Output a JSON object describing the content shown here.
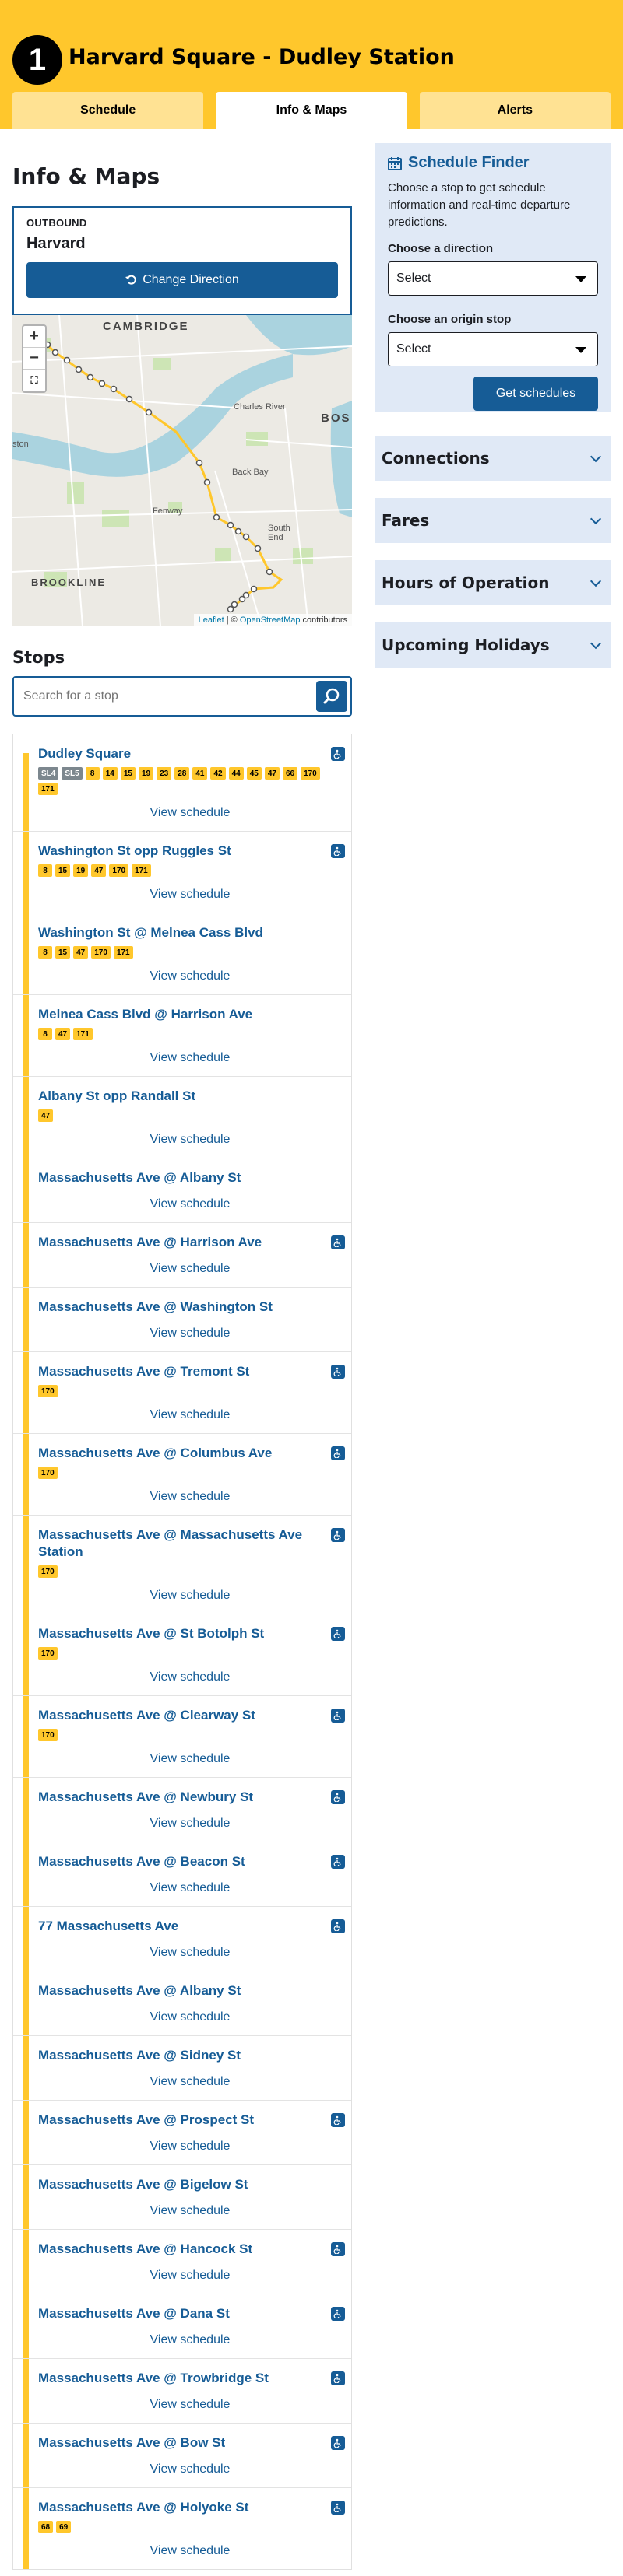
{
  "header": {
    "route_number": "1",
    "route_name": "Harvard Square - Dudley Station",
    "tabs": [
      {
        "label": "Schedule"
      },
      {
        "label": "Info & Maps"
      },
      {
        "label": "Alerts"
      }
    ],
    "active_tab": "Info & Maps"
  },
  "main": {
    "title": "Info & Maps",
    "direction": {
      "label": "OUTBOUND",
      "destination": "Harvard",
      "change_label": "Change Direction"
    },
    "map": {
      "labels": [
        "CAMBRIDGE",
        "BOS",
        "Charles River",
        "Back Bay",
        "Fenway",
        "South End",
        "BROOKLINE",
        "ston"
      ],
      "attribution_leaflet": "Leaflet",
      "attribution_sep": " | © ",
      "attribution_osm": "OpenStreetMap",
      "attribution_tail": " contributors",
      "zoom_in": "+",
      "zoom_out": "−"
    },
    "stops_heading": "Stops",
    "search_placeholder": "Search for a stop",
    "view_schedule_label": "View schedule",
    "stops": [
      {
        "name": "Dudley Square",
        "accessible": true,
        "routes": [
          "SL4",
          "SL5",
          "8",
          "14",
          "15",
          "19",
          "23",
          "28",
          "41",
          "42",
          "44",
          "45",
          "47",
          "66",
          "170",
          "171"
        ]
      },
      {
        "name": "Washington St opp Ruggles St",
        "accessible": true,
        "routes": [
          "8",
          "15",
          "19",
          "47",
          "170",
          "171"
        ]
      },
      {
        "name": "Washington St @ Melnea Cass Blvd",
        "accessible": false,
        "routes": [
          "8",
          "15",
          "47",
          "170",
          "171"
        ]
      },
      {
        "name": "Melnea Cass Blvd @ Harrison Ave",
        "accessible": false,
        "routes": [
          "8",
          "47",
          "171"
        ]
      },
      {
        "name": "Albany St opp Randall St",
        "accessible": false,
        "routes": [
          "47"
        ]
      },
      {
        "name": "Massachusetts Ave @ Albany St",
        "accessible": false,
        "routes": []
      },
      {
        "name": "Massachusetts Ave @ Harrison Ave",
        "accessible": true,
        "routes": []
      },
      {
        "name": "Massachusetts Ave @ Washington St",
        "accessible": false,
        "routes": []
      },
      {
        "name": "Massachusetts Ave @ Tremont St",
        "accessible": true,
        "routes": [
          "170"
        ]
      },
      {
        "name": "Massachusetts Ave @ Columbus Ave",
        "accessible": true,
        "routes": [
          "170"
        ]
      },
      {
        "name": "Massachusetts Ave @ Massachusetts Ave Station",
        "accessible": true,
        "routes": [
          "170"
        ]
      },
      {
        "name": "Massachusetts Ave @ St Botolph St",
        "accessible": true,
        "routes": [
          "170"
        ]
      },
      {
        "name": "Massachusetts Ave @ Clearway St",
        "accessible": true,
        "routes": [
          "170"
        ]
      },
      {
        "name": "Massachusetts Ave @ Newbury St",
        "accessible": true,
        "routes": []
      },
      {
        "name": "Massachusetts Ave @ Beacon St",
        "accessible": true,
        "routes": []
      },
      {
        "name": "77 Massachusetts Ave",
        "accessible": true,
        "routes": []
      },
      {
        "name": "Massachusetts Ave @ Albany St",
        "accessible": false,
        "routes": []
      },
      {
        "name": "Massachusetts Ave @ Sidney St",
        "accessible": false,
        "routes": []
      },
      {
        "name": "Massachusetts Ave @ Prospect St",
        "accessible": true,
        "routes": []
      },
      {
        "name": "Massachusetts Ave @ Bigelow St",
        "accessible": false,
        "routes": []
      },
      {
        "name": "Massachusetts Ave @ Hancock St",
        "accessible": true,
        "routes": []
      },
      {
        "name": "Massachusetts Ave @ Dana St",
        "accessible": true,
        "routes": []
      },
      {
        "name": "Massachusetts Ave @ Trowbridge St",
        "accessible": true,
        "routes": []
      },
      {
        "name": "Massachusetts Ave @ Bow St",
        "accessible": true,
        "routes": []
      },
      {
        "name": "Massachusetts Ave @ Holyoke St",
        "accessible": true,
        "routes": [
          "68",
          "69"
        ]
      }
    ]
  },
  "sidebar": {
    "finder_title": "Schedule Finder",
    "finder_desc": "Choose a stop to get schedule information and real-time departure predictions.",
    "direction_label": "Choose a direction",
    "direction_value": "Select",
    "origin_label": "Choose an origin stop",
    "origin_value": "Select",
    "get_label": "Get schedules",
    "accordions": [
      "Connections",
      "Fares",
      "Hours of Operation",
      "Upcoming Holidays"
    ]
  },
  "colors": {
    "bus_yellow": "#ffc72c",
    "link_blue": "#165c96",
    "panel_blue": "#e0e9f6",
    "silver_line": "#7c878e"
  }
}
